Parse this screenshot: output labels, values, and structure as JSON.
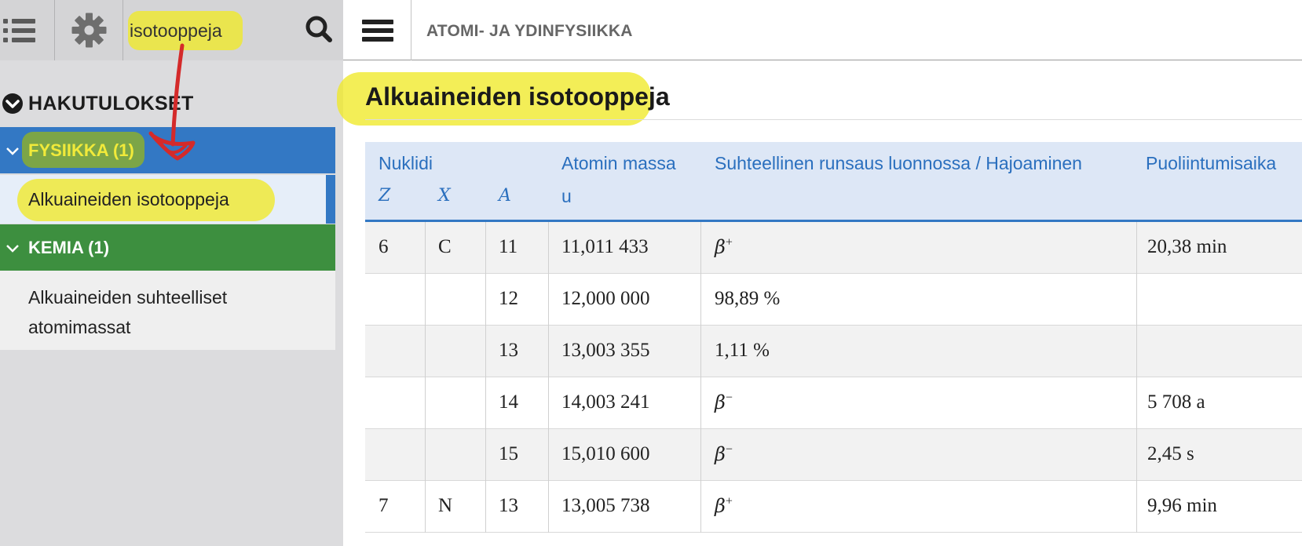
{
  "toolbar": {
    "search_value": "isotooppeja"
  },
  "results": {
    "heading": "HAKUTULOKSET",
    "groups": [
      {
        "label": "FYSIIKKA (1)",
        "color": "#3378c4",
        "items": [
          "Alkuaineiden isotooppeja"
        ]
      },
      {
        "label": "KEMIA (1)",
        "color": "#3d8f3f",
        "items": [
          "Alkuaineiden suhteelliset atomimassat"
        ]
      }
    ]
  },
  "main": {
    "breadcrumb": "ATOMI- JA YDINFYSIIKKA",
    "title": "Alkuaineiden isotooppeja"
  },
  "table": {
    "headers": {
      "nuklidi": "Nuklidi",
      "z": "Z",
      "x": "X",
      "a": "A",
      "mass": "Atomin massa",
      "mass_unit": "u",
      "abundance": "Suhteellinen runsaus luonnossa / Hajoaminen",
      "halflife": "Puoliintumisaika"
    },
    "rows": [
      {
        "z": "6",
        "x": "C",
        "a": "11",
        "mass": "11,011 433",
        "decay_symbol": "β",
        "decay_sign": "+",
        "abundance": "",
        "halflife": "20,38 min"
      },
      {
        "z": "",
        "x": "",
        "a": "12",
        "mass": "12,000 000",
        "decay_symbol": "",
        "decay_sign": "",
        "abundance": "98,89 %",
        "halflife": ""
      },
      {
        "z": "",
        "x": "",
        "a": "13",
        "mass": "13,003 355",
        "decay_symbol": "",
        "decay_sign": "",
        "abundance": "1,11 %",
        "halflife": ""
      },
      {
        "z": "",
        "x": "",
        "a": "14",
        "mass": "14,003 241",
        "decay_symbol": "β",
        "decay_sign": "−",
        "abundance": "",
        "halflife": "5 708 a"
      },
      {
        "z": "",
        "x": "",
        "a": "15",
        "mass": "15,010 600",
        "decay_symbol": "β",
        "decay_sign": "−",
        "abundance": "",
        "halflife": "2,45 s"
      },
      {
        "z": "7",
        "x": "N",
        "a": "13",
        "mass": "13,005 738",
        "decay_symbol": "β",
        "decay_sign": "+",
        "abundance": "",
        "halflife": "9,96 min"
      }
    ]
  },
  "colors": {
    "accent_blue": "#3378c4",
    "group_green": "#3d8f3f",
    "highlight_yellow": "#f0e928",
    "annotation_red": "#d42a2a"
  },
  "icons": [
    "list-icon",
    "gear-icon",
    "search-icon",
    "chevron-circle-down-icon",
    "chevron-down-icon",
    "hamburger-icon"
  ]
}
